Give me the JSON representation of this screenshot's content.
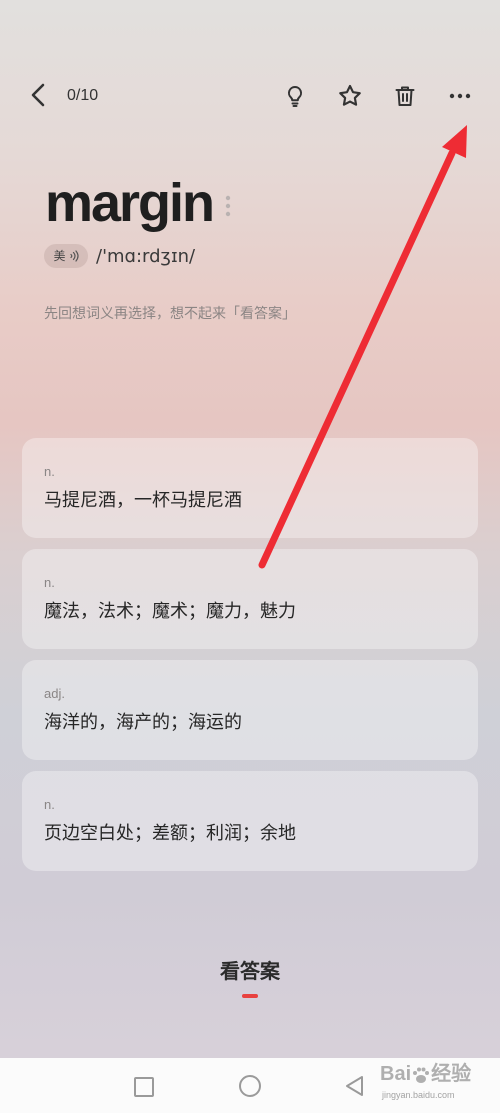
{
  "top_bar": {
    "back_icon": "chevron-left-icon",
    "progress": "0/10",
    "actions": [
      "lightbulb-icon",
      "star-icon",
      "trash-icon",
      "more-icon"
    ]
  },
  "word": {
    "text": "margin",
    "menu_icon": "vertical-dots-icon",
    "accent": "美",
    "speaker_icon": "speaker-icon",
    "phonetic": "/'mɑ:rdʒɪn/"
  },
  "hint": "先回想词义再选择，想不起来「看答案」",
  "options": [
    {
      "pos": "n.",
      "meaning": "马提尼酒，一杯马提尼酒"
    },
    {
      "pos": "n.",
      "meaning": "魔法，法术；魔术；魔力，魅力"
    },
    {
      "pos": "adj.",
      "meaning": "海洋的，海产的；海运的"
    },
    {
      "pos": "n.",
      "meaning": "页边空白处；差额；利润；余地"
    }
  ],
  "show_answer": "看答案",
  "system_nav": {
    "icons": [
      "square-icon",
      "circle-icon",
      "triangle-back-icon"
    ]
  },
  "watermark": {
    "brand_left": "Bai",
    "brand_right": "经验",
    "url": "jingyan.baidu.com"
  },
  "colors": {
    "accent": "#e8413f",
    "text": "#2a2a2a",
    "muted": "#8a8585",
    "annotation_arrow": "#ee2c34"
  }
}
